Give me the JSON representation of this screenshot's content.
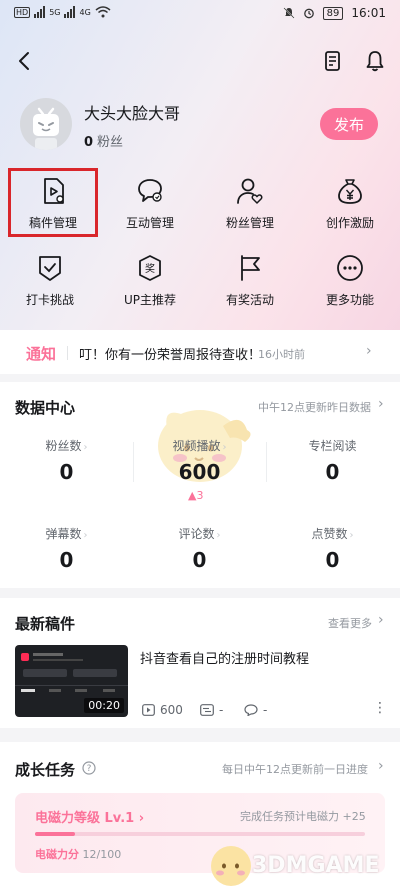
{
  "status_bar": {
    "time": "16:01",
    "battery": "89",
    "network_left": "HD",
    "network_tag": "5G",
    "network_tag2": "4G"
  },
  "header": {
    "back_icon": "chevron-left-icon",
    "doc_icon": "document-icon",
    "bell_icon": "bell-icon"
  },
  "profile": {
    "username": "大头大脸大哥",
    "fans_count": "0",
    "fans_label": "粉丝",
    "publish_label": "发布"
  },
  "grid": [
    {
      "label": "稿件管理",
      "icon": "video-file-icon"
    },
    {
      "label": "互动管理",
      "icon": "chat-bubble-icon"
    },
    {
      "label": "粉丝管理",
      "icon": "user-heart-icon"
    },
    {
      "label": "创作激励",
      "icon": "money-bag-icon"
    },
    {
      "label": "打卡挑战",
      "icon": "check-shield-icon"
    },
    {
      "label": "UP主推荐",
      "icon": "recommend-badge-icon"
    },
    {
      "label": "有奖活动",
      "icon": "flag-icon"
    },
    {
      "label": "更多功能",
      "icon": "more-dots-icon"
    }
  ],
  "notice": {
    "tag": "通知",
    "text": "叮！你有一份荣誉周报待查收！",
    "time": "16小时前"
  },
  "data_center": {
    "title": "数据中心",
    "update_note": "中午12点更新昨日数据",
    "stats": [
      {
        "label": "粉丝数",
        "value": "0"
      },
      {
        "label": "视频播放",
        "value": "600",
        "delta": "▲3"
      },
      {
        "label": "专栏阅读",
        "value": "0"
      },
      {
        "label": "弹幕数",
        "value": "0"
      },
      {
        "label": "评论数",
        "value": "0"
      },
      {
        "label": "点赞数",
        "value": "0"
      }
    ]
  },
  "latest": {
    "title": "最新稿件",
    "more": "查看更多",
    "video": {
      "title": "抖音查看自己的注册时间教程",
      "duration": "00:20",
      "plays": "600",
      "danmaku": "-",
      "comments": "-"
    }
  },
  "growth": {
    "title": "成长任务",
    "update_note": "每日中午12点更新前一日进度",
    "level_label": "电磁力等级 Lv.1",
    "task_note": "完成任务预计电磁力 +25",
    "points_label": "电磁力分",
    "points_value": "12/100",
    "progress": 0.12
  },
  "watermark": "3DMGAME"
}
